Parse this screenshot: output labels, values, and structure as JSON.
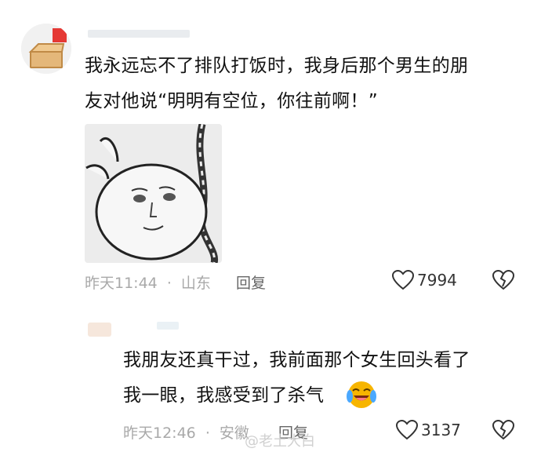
{
  "comment1": {
    "line1": "我永远忘不了排队打饭时，我身后那个男生的朋",
    "line2": "友对他说“明明有空位，你往前啊！”",
    "time": "昨天11:44",
    "dot": "·",
    "location": "山东",
    "reply": "回复",
    "likes": "7994"
  },
  "comment2": {
    "line1": "我朋友还真干过，我前面那个女生回头看了",
    "line2": "我一眼，我感受到了杀气",
    "time": "昨天12:46",
    "dot": "·",
    "location": "安徽",
    "reply": "回复",
    "likes": "3137"
  },
  "watermark": "@老土大白",
  "icons": {
    "like": "heart-outline-icon",
    "dislike": "broken-heart-icon",
    "emoji": "laughing-crying-emoji-icon"
  },
  "colors": {
    "meta": "#a9a9a9",
    "text": "#111111",
    "emoji_yellow": "#f7b500"
  }
}
